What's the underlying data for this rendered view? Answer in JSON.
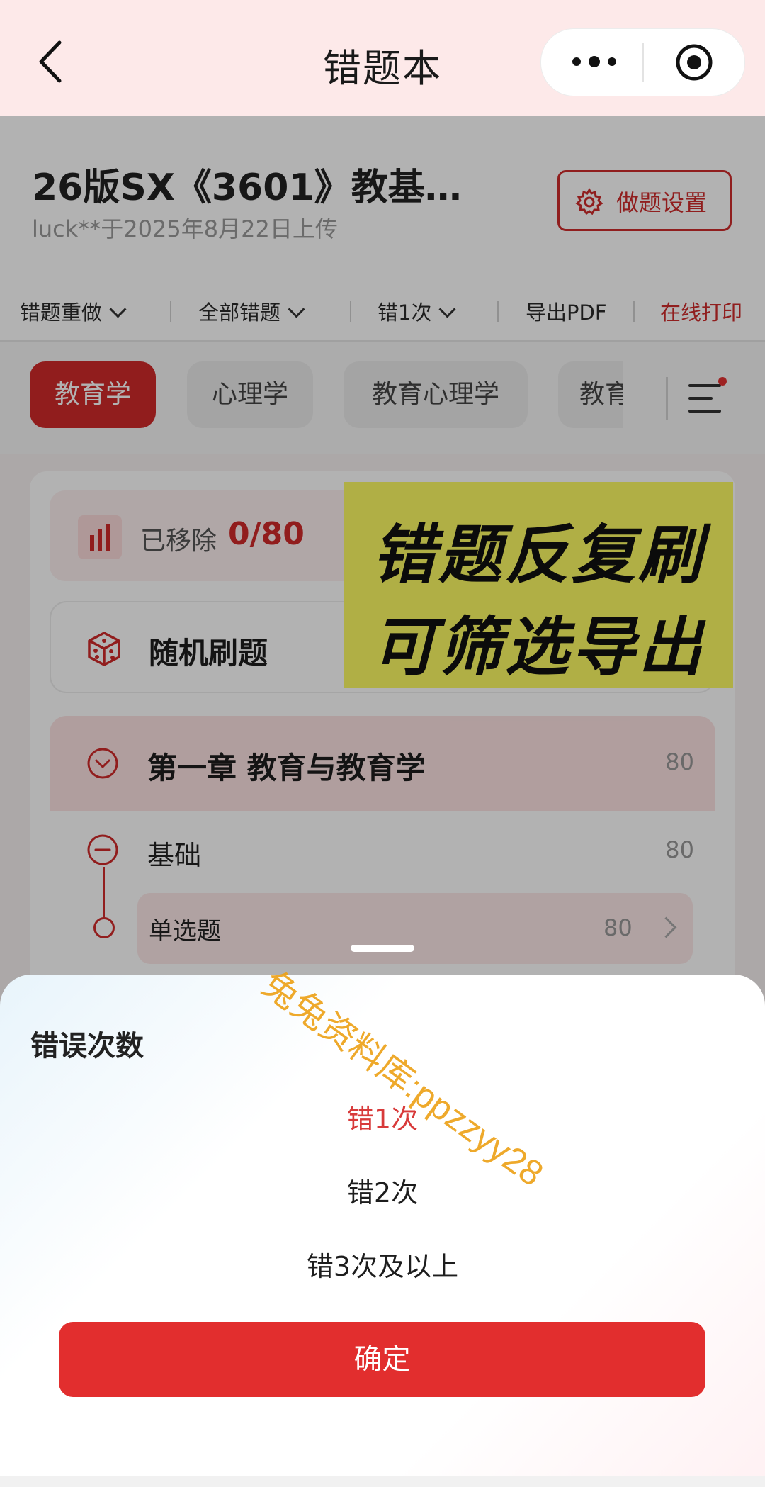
{
  "nav": {
    "title": "错题本"
  },
  "book": {
    "title": "26版SX《3601》教基…",
    "subtitle": "luck**于2025年8月22日上传",
    "settings_label": "做题设置"
  },
  "filters": [
    {
      "label": "错题重做"
    },
    {
      "label": "全部错题"
    },
    {
      "label": "错1次"
    },
    {
      "label": "导出PDF"
    },
    {
      "label": "在线打印"
    }
  ],
  "tabs": [
    {
      "label": "教育学"
    },
    {
      "label": "心理学"
    },
    {
      "label": "教育心理学"
    },
    {
      "label": "教育"
    }
  ],
  "stats": {
    "label": "已移除",
    "value": "0/80"
  },
  "random": {
    "label": "随机刷题"
  },
  "chapter": {
    "label": "第一章 教育与教育学",
    "count": "80"
  },
  "basic": {
    "label": "基础",
    "count": "80"
  },
  "single": {
    "label": "单选题",
    "count": "80"
  },
  "promo": {
    "line1": "错题反复刷",
    "line2": "可筛选导出"
  },
  "watermark": "兔兔资料库:ppzzyy28",
  "sheet": {
    "title": "错误次数",
    "options": [
      {
        "label": "错1次",
        "selected": true
      },
      {
        "label": "错2次",
        "selected": false
      },
      {
        "label": "错3次及以上",
        "selected": false
      }
    ],
    "confirm_label": "确定"
  },
  "colors": {
    "accent": "#d02a2a",
    "promo": "#fdfb63",
    "nav_bg": "#fde9e9"
  }
}
